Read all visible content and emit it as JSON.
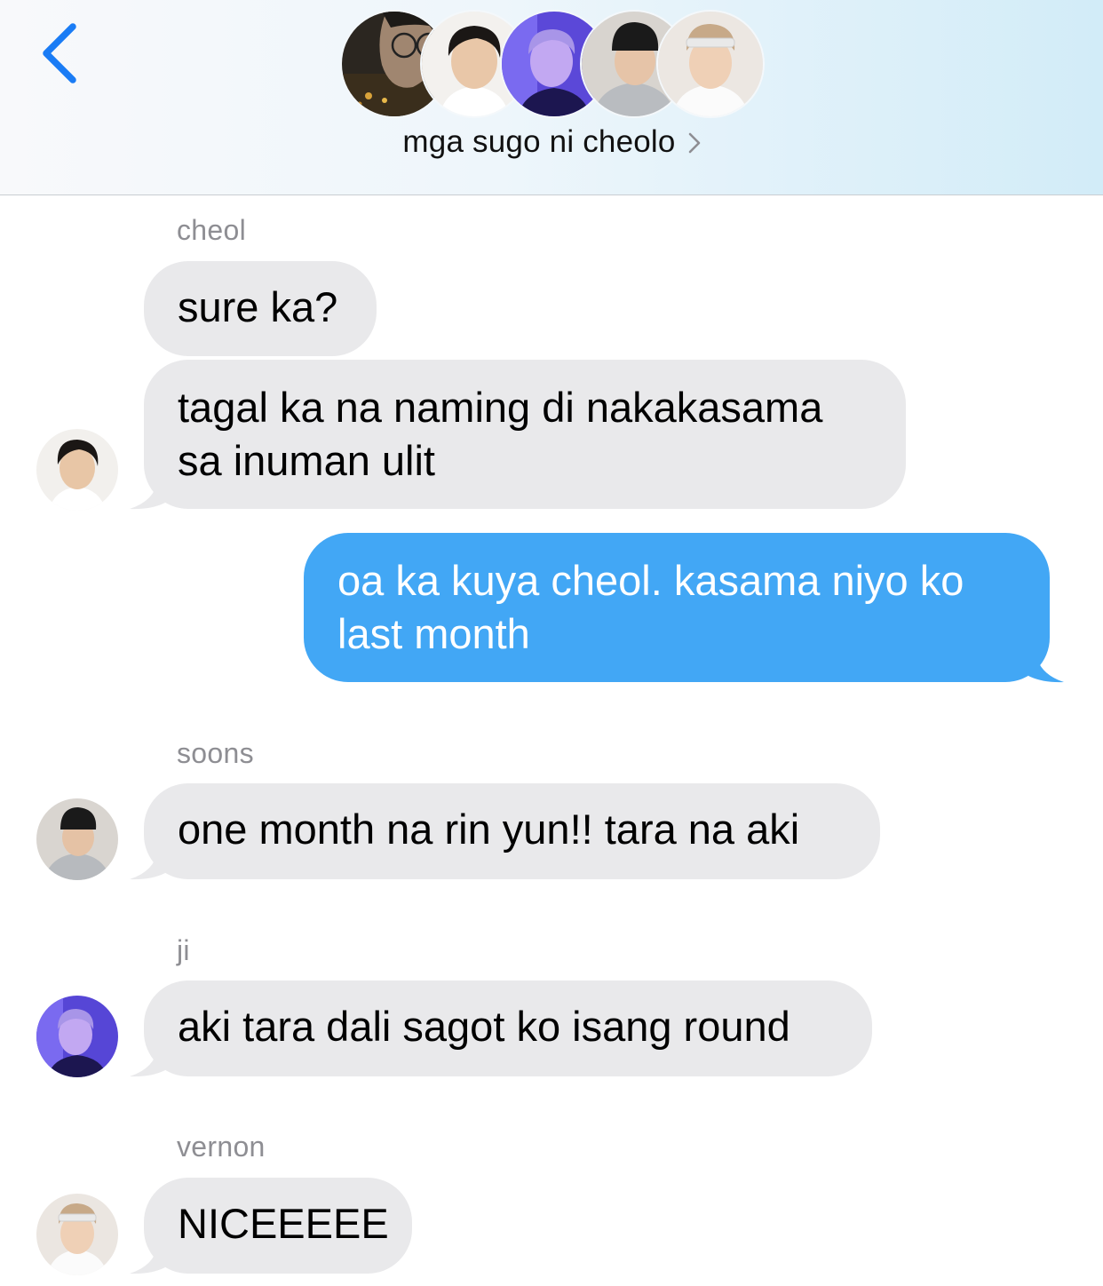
{
  "header": {
    "back_icon": "chevron-left-icon",
    "group_name": "mga sugo ni cheolo",
    "chevron_icon": "chevron-right-icon",
    "accent_color": "#1a7cf5",
    "member_avatars": [
      "cheol",
      "ji-hoon",
      "ji",
      "soons",
      "vernon"
    ]
  },
  "messages": [
    {
      "sender": "cheol",
      "text": "sure ka?",
      "direction": "incoming"
    },
    {
      "sender": "cheol",
      "text": "tagal ka na naming di nakakasama sa inuman ulit",
      "direction": "incoming"
    },
    {
      "sender": "me",
      "text": "oa ka kuya cheol. kasama niyo ko last month",
      "direction": "outgoing"
    },
    {
      "sender": "soons",
      "text": "one month na rin yun!! tara na aki",
      "direction": "incoming"
    },
    {
      "sender": "ji",
      "text": "aki tara dali sagot ko isang round",
      "direction": "incoming"
    },
    {
      "sender": "vernon",
      "text": "NICEEEEE",
      "direction": "incoming"
    }
  ],
  "labels": {
    "cheol": "cheol",
    "soons": "soons",
    "ji": "ji",
    "vernon": "vernon"
  },
  "colors": {
    "incoming_bubble": "#e9e9eb",
    "outgoing_bubble": "#42a7f5",
    "sender_name": "#8e8e93"
  }
}
